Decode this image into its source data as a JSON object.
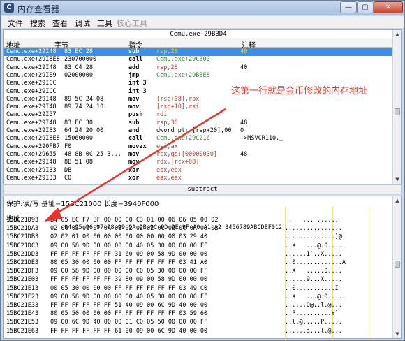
{
  "window": {
    "title": "内存查看器",
    "app_icon": "C",
    "min_glyph": "—",
    "max_glyph": "▢",
    "close_glyph": "✕"
  },
  "menu": [
    "文件",
    "搜索",
    "查看",
    "调试",
    "工具",
    "核心工具"
  ],
  "disassembly": {
    "header_title": "Cemu.exe+29BBD4",
    "columns": [
      "地址",
      "字节",
      "指令",
      "注释"
    ],
    "rows": [
      {
        "addr": "Cemu.exe+29I48",
        "bytes": "83 EC 28",
        "mn": "sub",
        "op": "rsp,28",
        "opc": "red",
        "cm": "40",
        "sel": true
      },
      {
        "addr": "Cemu.exe+29I8E8",
        "bytes": "230700000",
        "mn": "call",
        "op": "Cemu.exe+29C300",
        "opc": "green",
        "cm": ""
      },
      {
        "addr": "Cemu.exe+29I48",
        "bytes": "83 C4 28",
        "mn": "add",
        "op": "rsp,28",
        "opc": "red",
        "cm": "40"
      },
      {
        "addr": "Cemu.exe+29IE9",
        "bytes": "02000000",
        "mn": "jmp",
        "op": "Cemu.exe+29BBE8",
        "opc": "green",
        "cm": ""
      },
      {
        "addr": "Cemu.exe+29ICC",
        "bytes": "",
        "mn": "int 3",
        "op": "",
        "opc": "red",
        "cm": ""
      },
      {
        "addr": "Cemu.exe+29ICC",
        "bytes": "",
        "mn": "int 3",
        "op": "",
        "opc": "red",
        "cm": ""
      },
      {
        "addr": "Cemu.exe+29I48",
        "bytes": "89 5C 24 08",
        "mn": "mov",
        "op": "[rsp+08],rbx",
        "opc": "red",
        "cm": ""
      },
      {
        "addr": "Cemu.exe+29I48",
        "bytes": "89 74 24 10",
        "mn": "mov",
        "op": "[rsp+10],rsi",
        "opc": "red",
        "cm": ""
      },
      {
        "addr": "Cemu.exe+29I57",
        "bytes": "",
        "mn": "push",
        "op": "rdi",
        "opc": "red",
        "cm": ""
      },
      {
        "addr": "Cemu.exe+29I48",
        "bytes": "83 EC 30",
        "mn": "sub",
        "op": "rsp,30",
        "opc": "red",
        "cm": "48"
      },
      {
        "addr": "Cemu.exe+29I83",
        "bytes": "64 24 20 00",
        "mn": "and",
        "op": "dword ptr [rsp+20],00",
        "opc": "black",
        "cm": "0"
      },
      {
        "addr": "Cemu.exe+29I8E8",
        "bytes": "15060000",
        "mn": "call",
        "op": "Cemu.exe+29C216",
        "opc": "green",
        "cm": "->MSVCR110._"
      },
      {
        "addr": "Cemu.exe+290FB7",
        "bytes": "F0",
        "mn": "movzx",
        "op": "esi,ax",
        "opc": "red",
        "cm": ""
      },
      {
        "addr": "Cemu.exe+29655",
        "bytes": "48 8B 0C 25 3...",
        "mn": "mov",
        "op": "rcx,gs:[00000030]",
        "opc": "red",
        "cm": "48"
      },
      {
        "addr": "Cemu.exe+29I48",
        "bytes": "8B 51 08",
        "mn": "mov",
        "op": "rdx,[rcx+08]",
        "opc": "red",
        "cm": ""
      },
      {
        "addr": "Cemu.exe+29I33",
        "bytes": "DB",
        "mn": "xor",
        "op": "ebx,ebx",
        "opc": "red",
        "cm": ""
      },
      {
        "addr": "Cemu.exe+29I33",
        "bytes": "C0",
        "mn": "xor",
        "op": "eax,eax",
        "opc": "red",
        "cm": ""
      }
    ]
  },
  "annotation": {
    "text": "这第一行就是金币修改的内存地址",
    "color": "#e8342a"
  },
  "splitter_label": "subtract",
  "hex": {
    "status": "保护:读/写    基址=15BC21000  长度=3940F000",
    "addr_head": "地址",
    "header": "94 95 96 97 98 99 9A 9B 9C 9D 9E 9F A0 A1 A2 3456789ABCDEF012",
    "rows": [
      {
        "addr": "15BC21D93",
        "bytes": "B4 05 EC F7 BF 00 00 00 C3 01 00 06 06 05 00 02",
        "ascii": " .   ... ......"
      },
      {
        "addr": "15BC21DA3",
        "bytes": "02 06 03 06 07 0A 00 02 02 02 0C 06 0C 0A 00 02",
        "ascii": "................"
      },
      {
        "addr": "15BC21DB3",
        "bytes": "02 02 01 00 00 00 00 00 00 00 00 00 03 29 40",
        "ascii": "..............)@"
      },
      {
        "addr": "15BC21DC3",
        "bytes": "09 00 58 9D 00 00 00 00 40 05 30 00 00 00 FF",
        "ascii": "..X   ...@.0....."
      },
      {
        "addr": "15BC21DD3",
        "bytes": "FF FF FF FF FF FF 31 60 09 00 58 9D 00 00 00",
        "ascii": "......1`..X....."
      },
      {
        "addr": "15BC21DE3",
        "bytes": "80 05 30 00 00 00 FF FF FF FF FF FF 03 41 A0",
        "ascii": "..0.............A"
      },
      {
        "addr": "15BC21DF3",
        "bytes": "09 00 58 9D 00 00 00 00 C0 05 30 00 00 00 FF",
        "ascii": "..X   .....0...."
      },
      {
        "addr": "15BC21E03",
        "bytes": "FF FF FF FF FF FF 39 80 09 00 58 9D 00 00 00",
        "ascii": "......9...X....."
      },
      {
        "addr": "15BC21E13",
        "bytes": "00 05 30 00 00 00 FF FF FF FF FF FF 03 49 C0",
        "ascii": "..0...........I"
      },
      {
        "addr": "15BC21E23",
        "bytes": "09 00 58 9D 00 00 00 00 40 05 30 00 00 00 FF",
        "ascii": "..X   ...@.0....."
      },
      {
        "addr": "15BC21E33",
        "bytes": "FF FF FF FF FF FF 51 40 09 00 6C 9D 40 00 00",
        "ascii": "......Q@..l.@..."
      },
      {
        "addr": "15BC21E43",
        "bytes": "80 05 50 00 00 00 FF FF FF FF FF FF 03 59 60",
        "ascii": "..P..........Y`"
      },
      {
        "addr": "15BC21E53",
        "bytes": "09 00 6C 9D 40 00 00 01 C0 05 50 00 00 00 FF",
        "ascii": "..l.@.....P....."
      },
      {
        "addr": "15BC21E63",
        "bytes": "FF FF FF FF FF FF 61 00 09 00 6C 9D 40 00 00",
        "ascii": "......a...l.@..."
      }
    ]
  }
}
